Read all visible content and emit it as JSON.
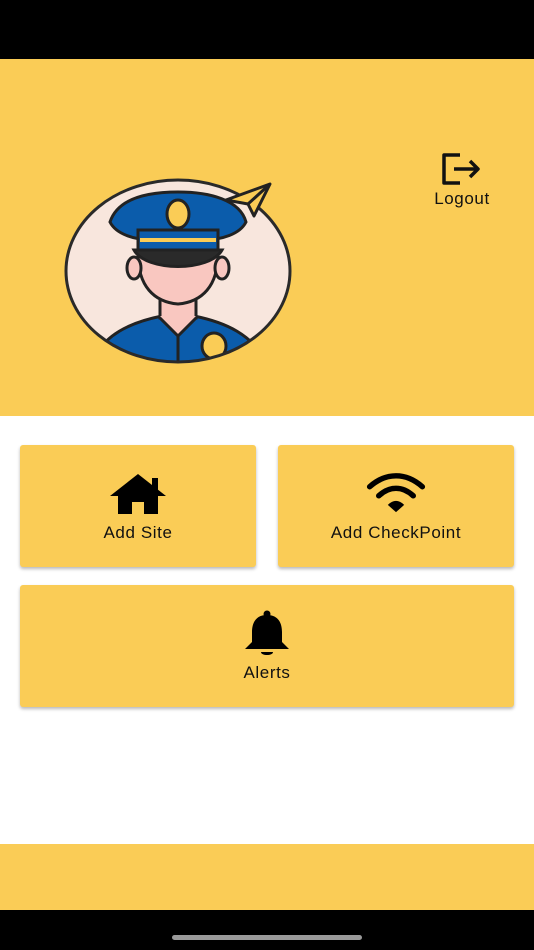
{
  "header": {
    "logout_label": "Logout",
    "logout_icon": "logout-icon",
    "avatar_icon": "security-guard-avatar-icon",
    "color": "#facc56"
  },
  "menu": {
    "add_site": {
      "label": "Add Site",
      "icon": "home-icon"
    },
    "add_checkpoint": {
      "label": "Add CheckPoint",
      "icon": "wifi-icon"
    },
    "alerts": {
      "label": "Alerts",
      "icon": "bell-icon"
    }
  },
  "colors": {
    "accent": "#facc56",
    "text": "#111111",
    "guard_blue": "#0b5cab",
    "background": "#ffffff"
  }
}
